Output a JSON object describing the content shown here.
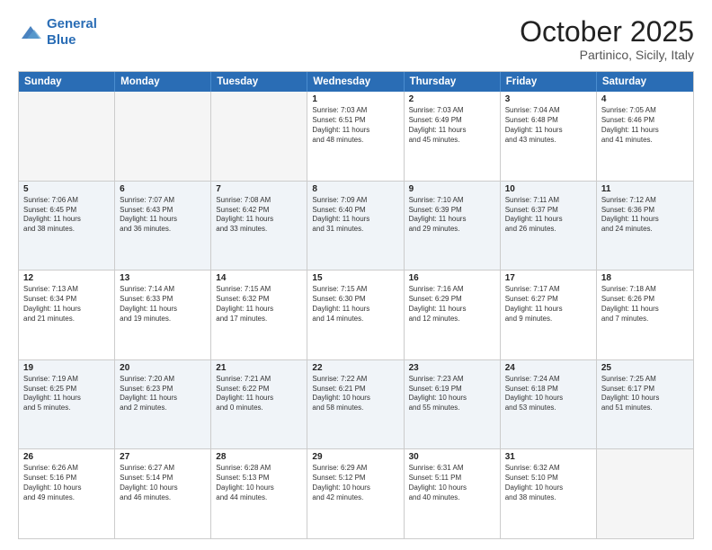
{
  "logo": {
    "line1": "General",
    "line2": "Blue"
  },
  "header": {
    "title": "October 2025",
    "location": "Partinico, Sicily, Italy"
  },
  "weekdays": [
    "Sunday",
    "Monday",
    "Tuesday",
    "Wednesday",
    "Thursday",
    "Friday",
    "Saturday"
  ],
  "rows": [
    [
      {
        "day": "",
        "info": "",
        "empty": true
      },
      {
        "day": "",
        "info": "",
        "empty": true
      },
      {
        "day": "",
        "info": "",
        "empty": true
      },
      {
        "day": "1",
        "info": "Sunrise: 7:03 AM\nSunset: 6:51 PM\nDaylight: 11 hours\nand 48 minutes."
      },
      {
        "day": "2",
        "info": "Sunrise: 7:03 AM\nSunset: 6:49 PM\nDaylight: 11 hours\nand 45 minutes."
      },
      {
        "day": "3",
        "info": "Sunrise: 7:04 AM\nSunset: 6:48 PM\nDaylight: 11 hours\nand 43 minutes."
      },
      {
        "day": "4",
        "info": "Sunrise: 7:05 AM\nSunset: 6:46 PM\nDaylight: 11 hours\nand 41 minutes."
      }
    ],
    [
      {
        "day": "5",
        "info": "Sunrise: 7:06 AM\nSunset: 6:45 PM\nDaylight: 11 hours\nand 38 minutes."
      },
      {
        "day": "6",
        "info": "Sunrise: 7:07 AM\nSunset: 6:43 PM\nDaylight: 11 hours\nand 36 minutes."
      },
      {
        "day": "7",
        "info": "Sunrise: 7:08 AM\nSunset: 6:42 PM\nDaylight: 11 hours\nand 33 minutes."
      },
      {
        "day": "8",
        "info": "Sunrise: 7:09 AM\nSunset: 6:40 PM\nDaylight: 11 hours\nand 31 minutes."
      },
      {
        "day": "9",
        "info": "Sunrise: 7:10 AM\nSunset: 6:39 PM\nDaylight: 11 hours\nand 29 minutes."
      },
      {
        "day": "10",
        "info": "Sunrise: 7:11 AM\nSunset: 6:37 PM\nDaylight: 11 hours\nand 26 minutes."
      },
      {
        "day": "11",
        "info": "Sunrise: 7:12 AM\nSunset: 6:36 PM\nDaylight: 11 hours\nand 24 minutes."
      }
    ],
    [
      {
        "day": "12",
        "info": "Sunrise: 7:13 AM\nSunset: 6:34 PM\nDaylight: 11 hours\nand 21 minutes."
      },
      {
        "day": "13",
        "info": "Sunrise: 7:14 AM\nSunset: 6:33 PM\nDaylight: 11 hours\nand 19 minutes."
      },
      {
        "day": "14",
        "info": "Sunrise: 7:15 AM\nSunset: 6:32 PM\nDaylight: 11 hours\nand 17 minutes."
      },
      {
        "day": "15",
        "info": "Sunrise: 7:15 AM\nSunset: 6:30 PM\nDaylight: 11 hours\nand 14 minutes."
      },
      {
        "day": "16",
        "info": "Sunrise: 7:16 AM\nSunset: 6:29 PM\nDaylight: 11 hours\nand 12 minutes."
      },
      {
        "day": "17",
        "info": "Sunrise: 7:17 AM\nSunset: 6:27 PM\nDaylight: 11 hours\nand 9 minutes."
      },
      {
        "day": "18",
        "info": "Sunrise: 7:18 AM\nSunset: 6:26 PM\nDaylight: 11 hours\nand 7 minutes."
      }
    ],
    [
      {
        "day": "19",
        "info": "Sunrise: 7:19 AM\nSunset: 6:25 PM\nDaylight: 11 hours\nand 5 minutes."
      },
      {
        "day": "20",
        "info": "Sunrise: 7:20 AM\nSunset: 6:23 PM\nDaylight: 11 hours\nand 2 minutes."
      },
      {
        "day": "21",
        "info": "Sunrise: 7:21 AM\nSunset: 6:22 PM\nDaylight: 11 hours\nand 0 minutes."
      },
      {
        "day": "22",
        "info": "Sunrise: 7:22 AM\nSunset: 6:21 PM\nDaylight: 10 hours\nand 58 minutes."
      },
      {
        "day": "23",
        "info": "Sunrise: 7:23 AM\nSunset: 6:19 PM\nDaylight: 10 hours\nand 55 minutes."
      },
      {
        "day": "24",
        "info": "Sunrise: 7:24 AM\nSunset: 6:18 PM\nDaylight: 10 hours\nand 53 minutes."
      },
      {
        "day": "25",
        "info": "Sunrise: 7:25 AM\nSunset: 6:17 PM\nDaylight: 10 hours\nand 51 minutes."
      }
    ],
    [
      {
        "day": "26",
        "info": "Sunrise: 6:26 AM\nSunset: 5:16 PM\nDaylight: 10 hours\nand 49 minutes."
      },
      {
        "day": "27",
        "info": "Sunrise: 6:27 AM\nSunset: 5:14 PM\nDaylight: 10 hours\nand 46 minutes."
      },
      {
        "day": "28",
        "info": "Sunrise: 6:28 AM\nSunset: 5:13 PM\nDaylight: 10 hours\nand 44 minutes."
      },
      {
        "day": "29",
        "info": "Sunrise: 6:29 AM\nSunset: 5:12 PM\nDaylight: 10 hours\nand 42 minutes."
      },
      {
        "day": "30",
        "info": "Sunrise: 6:31 AM\nSunset: 5:11 PM\nDaylight: 10 hours\nand 40 minutes."
      },
      {
        "day": "31",
        "info": "Sunrise: 6:32 AM\nSunset: 5:10 PM\nDaylight: 10 hours\nand 38 minutes."
      },
      {
        "day": "",
        "info": "",
        "empty": true
      }
    ]
  ]
}
